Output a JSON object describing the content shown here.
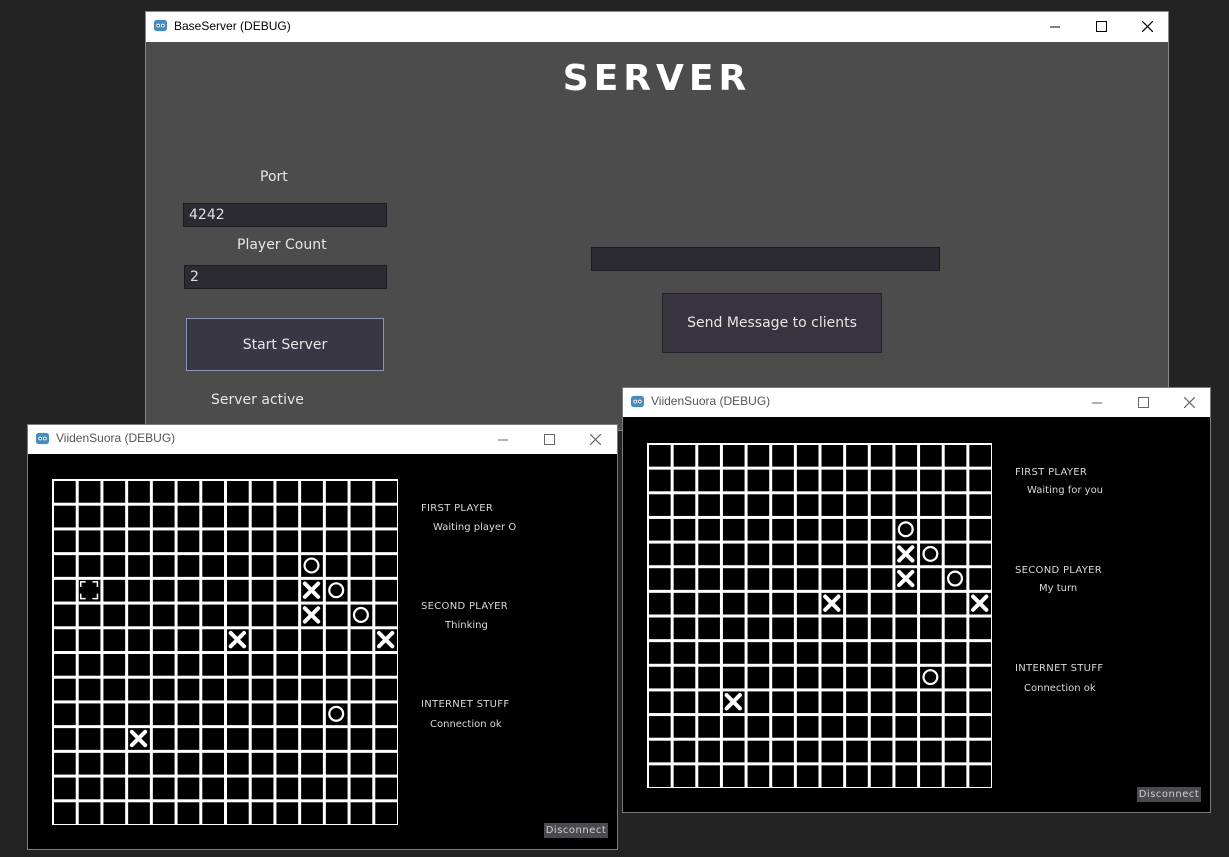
{
  "server": {
    "title": "BaseServer (DEBUG)",
    "heading": "SERVER",
    "port_label": "Port",
    "port_value": "4242",
    "player_count_label": "Player Count",
    "player_count_value": "2",
    "start_button": "Start Server",
    "status": "Server active",
    "message_value": "",
    "send_button": "Send Message to clients"
  },
  "client_left": {
    "title": "ViidenSuora (DEBUG)",
    "first_player_heading": "FIRST PLAYER",
    "first_player_status": "Waiting player O",
    "second_player_heading": "SECOND PLAYER",
    "second_player_status": "Thinking",
    "internet_heading": "INTERNET STUFF",
    "internet_status": "Connection ok",
    "disconnect": "Disconnect",
    "board": {
      "size": 14,
      "pieces": [
        {
          "row": 3,
          "col": 10,
          "mark": "O"
        },
        {
          "row": 4,
          "col": 10,
          "mark": "X"
        },
        {
          "row": 4,
          "col": 11,
          "mark": "O"
        },
        {
          "row": 5,
          "col": 10,
          "mark": "X"
        },
        {
          "row": 5,
          "col": 12,
          "mark": "O"
        },
        {
          "row": 6,
          "col": 7,
          "mark": "X"
        },
        {
          "row": 6,
          "col": 13,
          "mark": "X"
        },
        {
          "row": 9,
          "col": 11,
          "mark": "O"
        },
        {
          "row": 10,
          "col": 3,
          "mark": "X"
        }
      ],
      "cursor": {
        "row": 4,
        "col": 1
      }
    }
  },
  "client_right": {
    "title": "ViidenSuora (DEBUG)",
    "first_player_heading": "FIRST PLAYER",
    "first_player_status": "Waiting for you",
    "second_player_heading": "SECOND PLAYER",
    "second_player_status": "My turn",
    "internet_heading": "INTERNET STUFF",
    "internet_status": "Connection ok",
    "disconnect": "Disconnect",
    "board": {
      "size": 14,
      "pieces": [
        {
          "row": 3,
          "col": 10,
          "mark": "O"
        },
        {
          "row": 4,
          "col": 10,
          "mark": "X"
        },
        {
          "row": 4,
          "col": 11,
          "mark": "O"
        },
        {
          "row": 5,
          "col": 10,
          "mark": "X"
        },
        {
          "row": 5,
          "col": 12,
          "mark": "O"
        },
        {
          "row": 6,
          "col": 7,
          "mark": "X"
        },
        {
          "row": 6,
          "col": 13,
          "mark": "X"
        },
        {
          "row": 9,
          "col": 11,
          "mark": "O"
        },
        {
          "row": 10,
          "col": 3,
          "mark": "X"
        }
      ]
    }
  },
  "icons": {
    "app": "godot-icon",
    "minimize": "minimize-icon",
    "maximize": "maximize-icon",
    "close": "close-icon"
  }
}
